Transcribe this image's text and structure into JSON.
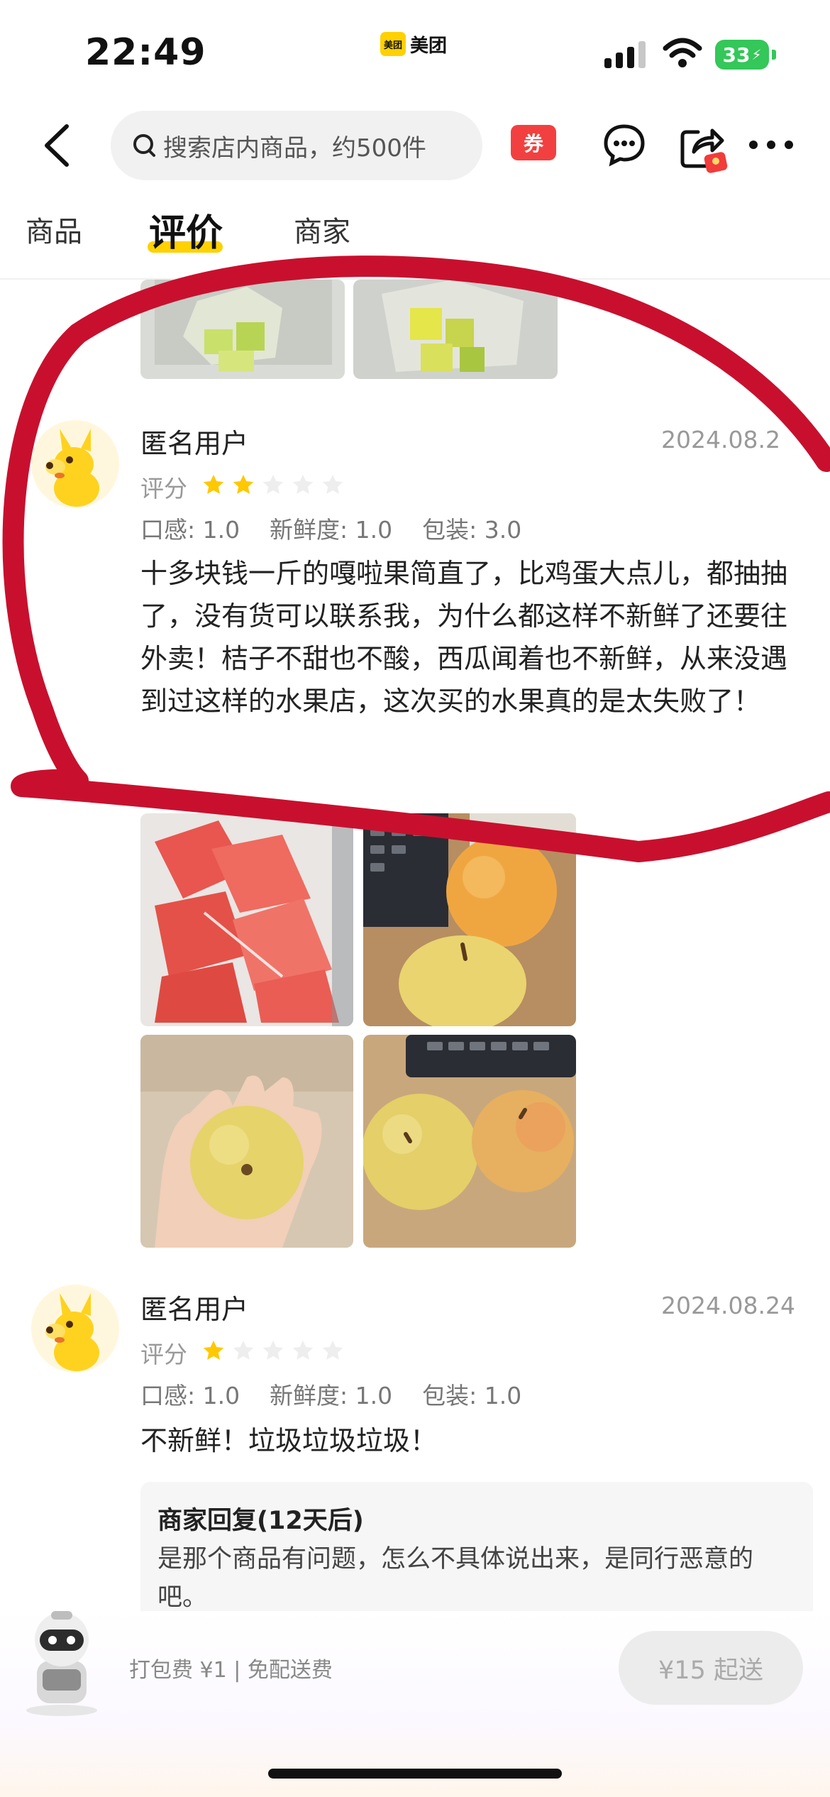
{
  "status_bar": {
    "time": "22:49",
    "app_badge": "美团",
    "battery": "33"
  },
  "header": {
    "search_placeholder": "搜索店内商品，约500件",
    "coupon_label": "券"
  },
  "tabs": [
    {
      "label": "商品"
    },
    {
      "label": "评价",
      "active": true
    },
    {
      "label": "商家"
    }
  ],
  "reviews": [
    {
      "user": "匿名用户",
      "date": "2024.08.2",
      "rating_label": "评分",
      "stars": 2,
      "scores": "口感: 1.0    新鲜度: 1.0    包装: 3.0",
      "text": "十多块钱一斤的嘎啦果简直了，比鸡蛋大点儿，都抽抽了，没有货可以联系我，为什么都这样不新鲜了还要往外卖！桔子不甜也不酸，西瓜闻着也不新鲜，从来没遇到过这样的水果店，这次买的水果真的是太失败了！",
      "photos": [
        "watermelon",
        "orange-apple",
        "apple-in-hand",
        "two-apples"
      ]
    },
    {
      "user": "匿名用户",
      "date": "2024.08.24",
      "rating_label": "评分",
      "stars": 1,
      "scores": "口感: 1.0    新鲜度: 1.0    包装: 1.0",
      "text": "不新鲜！垃圾垃圾垃圾！",
      "reply_title": "商家回复(12天后)",
      "reply_text": "是那个商品有问题，怎么不具体说出来，是同行恶意的吧。"
    }
  ],
  "bottom_bar": {
    "fee_text": "打包费 ¥1 | 免配送费",
    "min_order": "¥15 起送"
  },
  "colors": {
    "accent": "#ffd100",
    "star": "#ffc800",
    "annotation": "#c8102e"
  }
}
